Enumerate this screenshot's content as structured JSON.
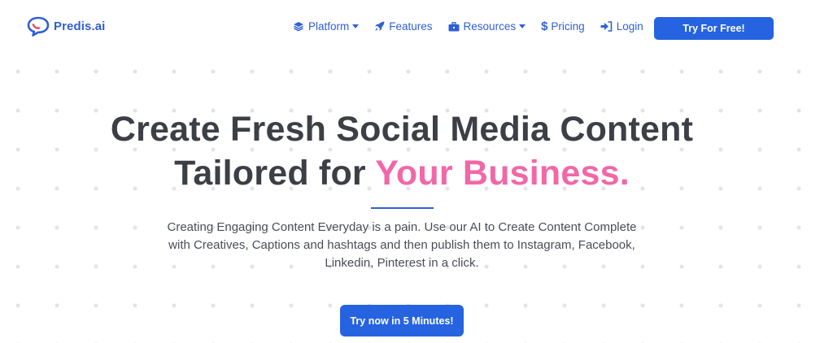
{
  "brand": {
    "name": "Predis.ai",
    "color": "#2f5fd7"
  },
  "nav": {
    "items": [
      {
        "label": "Platform",
        "icon": "layers-icon",
        "dropdown": true
      },
      {
        "label": "Features",
        "icon": "rocket-icon",
        "dropdown": false
      },
      {
        "label": "Resources",
        "icon": "briefcase-icon",
        "dropdown": true
      },
      {
        "label": "Pricing",
        "icon": "dollar-icon",
        "dropdown": false
      },
      {
        "label": "Login",
        "icon": "sign-in-icon",
        "dropdown": false
      }
    ],
    "cta_label": "Try For Free!"
  },
  "hero": {
    "headline_line1": "Create Fresh Social Media Content",
    "headline_line2_prefix": "Tailored for ",
    "headline_line2_accent": "Your Business.",
    "subtitle": "Creating Engaging Content Everyday is a pain. Use our AI to Create Content Complete with Creatives, Captions and hashtags and then publish them to Instagram, Facebook, Linkedin, Pinterest in a click.",
    "cta_label": "Try now in 5 Minutes!"
  },
  "colors": {
    "accent_pink": "#f267a8",
    "primary_blue": "#2563e0",
    "heading": "#3d3f47"
  }
}
